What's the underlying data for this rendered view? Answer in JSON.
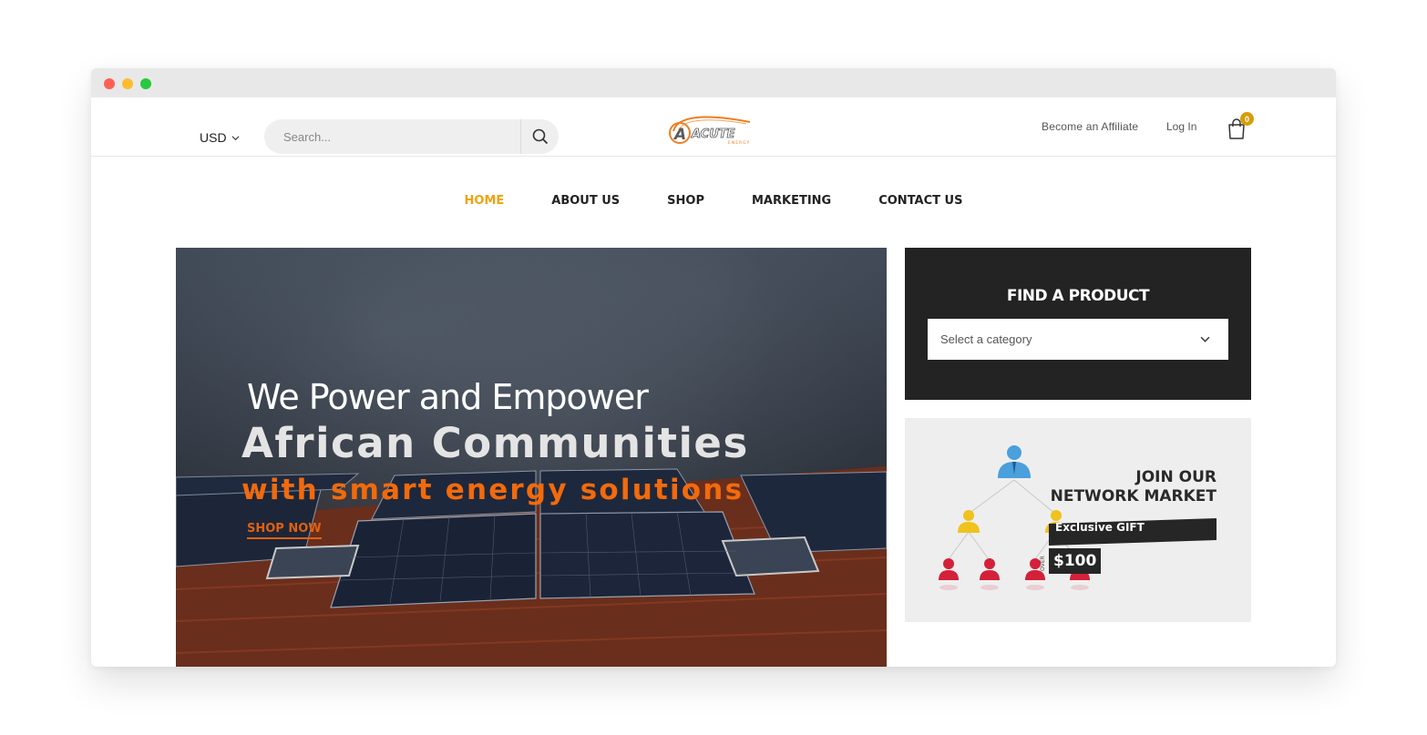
{
  "header": {
    "currency": "USD",
    "search_placeholder": "Search...",
    "logo_text": "ACUTE",
    "logo_subtext": "ENERGY",
    "affiliate_link": "Become an Affiliate",
    "login_link": "Log In",
    "cart_count": "0"
  },
  "nav": {
    "items": [
      {
        "label": "HOME",
        "active": true
      },
      {
        "label": "ABOUT US",
        "active": false
      },
      {
        "label": "SHOP",
        "active": false
      },
      {
        "label": "MARKETING",
        "active": false
      },
      {
        "label": "CONTACT US",
        "active": false
      }
    ]
  },
  "hero": {
    "line1": "We Power and Empower",
    "line2": "African Communities",
    "line3": "with smart energy solutions",
    "cta": "SHOP NOW"
  },
  "find_product": {
    "title": "FIND A PRODUCT",
    "select_value": "Select a category"
  },
  "network": {
    "title_line1": "JOIN OUR",
    "title_line2": "NETWORK MARKET",
    "gift_label": "Exclusive GIFT",
    "over_label": "OVER",
    "price": "$100"
  },
  "colors": {
    "accent": "#f2a20b",
    "hero_orange": "#f26a0c",
    "dark_panel": "#232323",
    "badge": "#d79d0b"
  }
}
